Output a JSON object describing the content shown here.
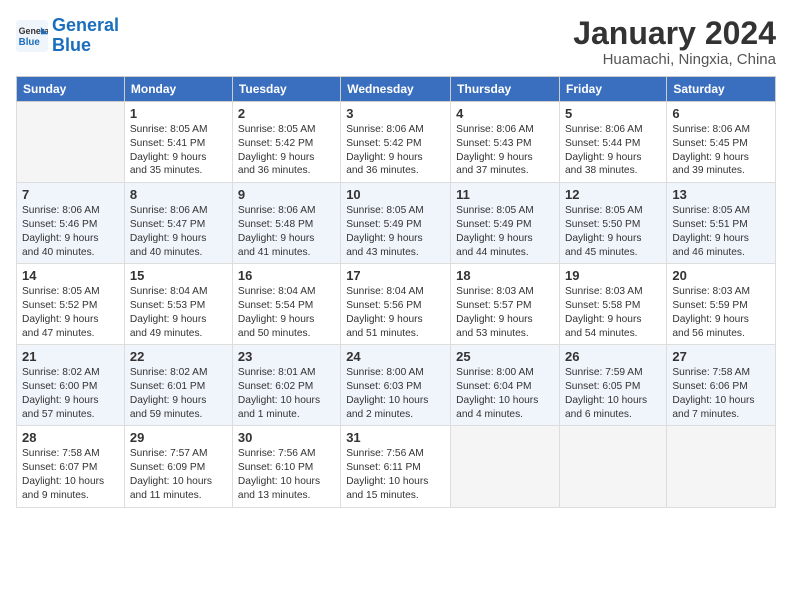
{
  "logo": {
    "text_general": "General",
    "text_blue": "Blue"
  },
  "header": {
    "title": "January 2024",
    "subtitle": "Huamachi, Ningxia, China"
  },
  "days_of_week": [
    "Sunday",
    "Monday",
    "Tuesday",
    "Wednesday",
    "Thursday",
    "Friday",
    "Saturday"
  ],
  "weeks": [
    {
      "days": [
        {
          "num": "",
          "info": ""
        },
        {
          "num": "1",
          "info": "Sunrise: 8:05 AM\nSunset: 5:41 PM\nDaylight: 9 hours\nand 35 minutes."
        },
        {
          "num": "2",
          "info": "Sunrise: 8:05 AM\nSunset: 5:42 PM\nDaylight: 9 hours\nand 36 minutes."
        },
        {
          "num": "3",
          "info": "Sunrise: 8:06 AM\nSunset: 5:42 PM\nDaylight: 9 hours\nand 36 minutes."
        },
        {
          "num": "4",
          "info": "Sunrise: 8:06 AM\nSunset: 5:43 PM\nDaylight: 9 hours\nand 37 minutes."
        },
        {
          "num": "5",
          "info": "Sunrise: 8:06 AM\nSunset: 5:44 PM\nDaylight: 9 hours\nand 38 minutes."
        },
        {
          "num": "6",
          "info": "Sunrise: 8:06 AM\nSunset: 5:45 PM\nDaylight: 9 hours\nand 39 minutes."
        }
      ]
    },
    {
      "days": [
        {
          "num": "7",
          "info": "Sunrise: 8:06 AM\nSunset: 5:46 PM\nDaylight: 9 hours\nand 40 minutes."
        },
        {
          "num": "8",
          "info": "Sunrise: 8:06 AM\nSunset: 5:47 PM\nDaylight: 9 hours\nand 40 minutes."
        },
        {
          "num": "9",
          "info": "Sunrise: 8:06 AM\nSunset: 5:48 PM\nDaylight: 9 hours\nand 41 minutes."
        },
        {
          "num": "10",
          "info": "Sunrise: 8:05 AM\nSunset: 5:49 PM\nDaylight: 9 hours\nand 43 minutes."
        },
        {
          "num": "11",
          "info": "Sunrise: 8:05 AM\nSunset: 5:49 PM\nDaylight: 9 hours\nand 44 minutes."
        },
        {
          "num": "12",
          "info": "Sunrise: 8:05 AM\nSunset: 5:50 PM\nDaylight: 9 hours\nand 45 minutes."
        },
        {
          "num": "13",
          "info": "Sunrise: 8:05 AM\nSunset: 5:51 PM\nDaylight: 9 hours\nand 46 minutes."
        }
      ]
    },
    {
      "days": [
        {
          "num": "14",
          "info": "Sunrise: 8:05 AM\nSunset: 5:52 PM\nDaylight: 9 hours\nand 47 minutes."
        },
        {
          "num": "15",
          "info": "Sunrise: 8:04 AM\nSunset: 5:53 PM\nDaylight: 9 hours\nand 49 minutes."
        },
        {
          "num": "16",
          "info": "Sunrise: 8:04 AM\nSunset: 5:54 PM\nDaylight: 9 hours\nand 50 minutes."
        },
        {
          "num": "17",
          "info": "Sunrise: 8:04 AM\nSunset: 5:56 PM\nDaylight: 9 hours\nand 51 minutes."
        },
        {
          "num": "18",
          "info": "Sunrise: 8:03 AM\nSunset: 5:57 PM\nDaylight: 9 hours\nand 53 minutes."
        },
        {
          "num": "19",
          "info": "Sunrise: 8:03 AM\nSunset: 5:58 PM\nDaylight: 9 hours\nand 54 minutes."
        },
        {
          "num": "20",
          "info": "Sunrise: 8:03 AM\nSunset: 5:59 PM\nDaylight: 9 hours\nand 56 minutes."
        }
      ]
    },
    {
      "days": [
        {
          "num": "21",
          "info": "Sunrise: 8:02 AM\nSunset: 6:00 PM\nDaylight: 9 hours\nand 57 minutes."
        },
        {
          "num": "22",
          "info": "Sunrise: 8:02 AM\nSunset: 6:01 PM\nDaylight: 9 hours\nand 59 minutes."
        },
        {
          "num": "23",
          "info": "Sunrise: 8:01 AM\nSunset: 6:02 PM\nDaylight: 10 hours\nand 1 minute."
        },
        {
          "num": "24",
          "info": "Sunrise: 8:00 AM\nSunset: 6:03 PM\nDaylight: 10 hours\nand 2 minutes."
        },
        {
          "num": "25",
          "info": "Sunrise: 8:00 AM\nSunset: 6:04 PM\nDaylight: 10 hours\nand 4 minutes."
        },
        {
          "num": "26",
          "info": "Sunrise: 7:59 AM\nSunset: 6:05 PM\nDaylight: 10 hours\nand 6 minutes."
        },
        {
          "num": "27",
          "info": "Sunrise: 7:58 AM\nSunset: 6:06 PM\nDaylight: 10 hours\nand 7 minutes."
        }
      ]
    },
    {
      "days": [
        {
          "num": "28",
          "info": "Sunrise: 7:58 AM\nSunset: 6:07 PM\nDaylight: 10 hours\nand 9 minutes."
        },
        {
          "num": "29",
          "info": "Sunrise: 7:57 AM\nSunset: 6:09 PM\nDaylight: 10 hours\nand 11 minutes."
        },
        {
          "num": "30",
          "info": "Sunrise: 7:56 AM\nSunset: 6:10 PM\nDaylight: 10 hours\nand 13 minutes."
        },
        {
          "num": "31",
          "info": "Sunrise: 7:56 AM\nSunset: 6:11 PM\nDaylight: 10 hours\nand 15 minutes."
        },
        {
          "num": "",
          "info": ""
        },
        {
          "num": "",
          "info": ""
        },
        {
          "num": "",
          "info": ""
        }
      ]
    }
  ]
}
